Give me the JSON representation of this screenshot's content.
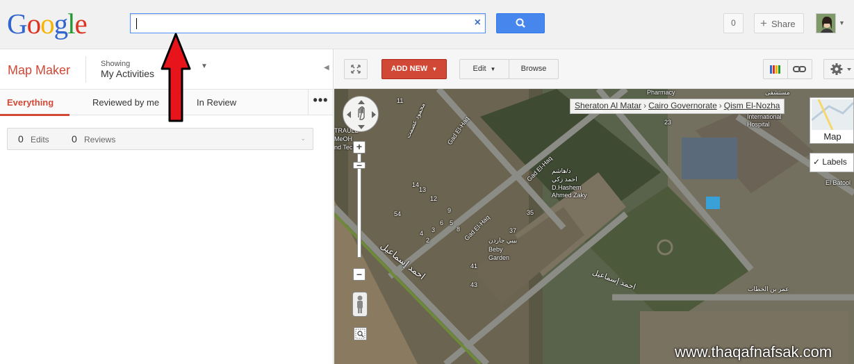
{
  "header": {
    "logo_letters": [
      "G",
      "o",
      "o",
      "g",
      "l",
      "e"
    ],
    "search": {
      "value": "",
      "placeholder": ""
    },
    "notifications_count": "0",
    "share_label": "Share"
  },
  "sidebar": {
    "app_title": "Map Maker",
    "showing_label": "Showing",
    "showing_value": "My Activities",
    "tabs": [
      {
        "label": "Everything",
        "active": true
      },
      {
        "label": "Reviewed by me",
        "active": false
      },
      {
        "label": "In Review",
        "active": false
      }
    ],
    "more_label": "•••",
    "stats": {
      "edits_count": "0",
      "edits_label": "Edits",
      "reviews_count": "0",
      "reviews_label": "Reviews"
    }
  },
  "toolbar": {
    "add_new_label": "ADD NEW",
    "edit_label": "Edit",
    "browse_label": "Browse"
  },
  "map": {
    "breadcrumb": [
      "Sheraton Al Matar",
      "Cairo Governorate",
      "Qism El-Nozha"
    ],
    "map_type_label": "Map",
    "labels_label": "Labels",
    "place_labels": [
      "Pharmacy",
      "Gad El-Haq",
      "Gad El-Haq",
      "Gad El-Haq",
      "د/هاشم",
      "احمد زكي",
      "D.Hashem",
      "Ahmed Zaky",
      "بيبي جاردن",
      "Beby",
      "Garden",
      "احمد إسماعيل",
      "احمد إسماعيل",
      "International",
      "Hospital",
      "El Batool",
      "عمر بن الخطاب",
      "مستشفى",
      "محمود عصمت",
      "TRAULL",
      "MeOH",
      "nd Tech",
      "11",
      "14",
      "13",
      "12",
      "9",
      "6",
      "3",
      "54",
      "35",
      "37",
      "41",
      "43",
      "23",
      "4",
      "2",
      "5",
      "8"
    ],
    "watermark": "www.thaqafnafsak.com"
  },
  "colors": {
    "accent_red": "#d14836",
    "search_blue": "#4787ed",
    "annotation_red": "#e8141c"
  }
}
